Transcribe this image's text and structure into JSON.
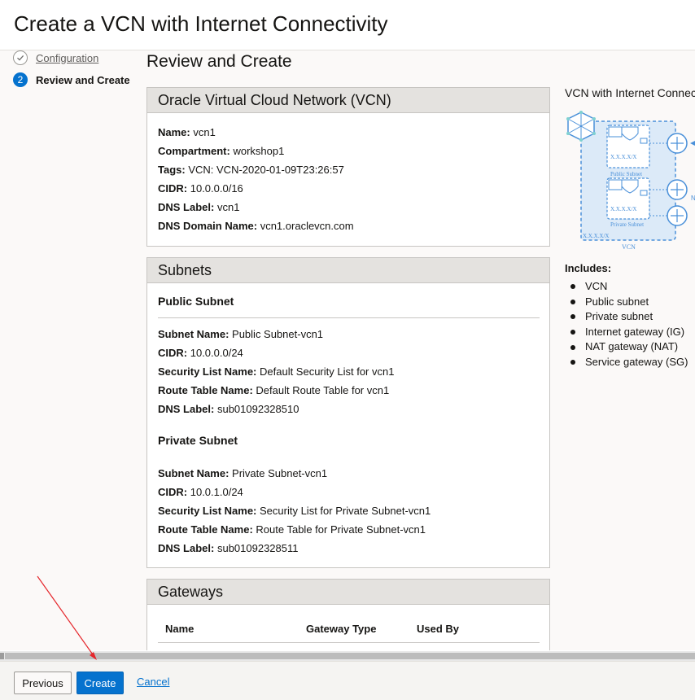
{
  "window": {
    "title": "Create a VCN with Internet Connectivity"
  },
  "steps": [
    {
      "label": "Configuration",
      "state": "complete"
    },
    {
      "number": "2",
      "label": "Review and Create",
      "state": "active"
    }
  ],
  "page_heading": "Review and Create",
  "vcn_panel": {
    "title": "Oracle Virtual Cloud Network (VCN)",
    "fields": [
      {
        "label": "Name:",
        "value": "vcn1"
      },
      {
        "label": "Compartment:",
        "value": "workshop1"
      },
      {
        "label": "Tags:",
        "value": "VCN: VCN-2020-01-09T23:26:57"
      },
      {
        "label": "CIDR:",
        "value": "10.0.0.0/16"
      },
      {
        "label": "DNS Label:",
        "value": "vcn1"
      },
      {
        "label": "DNS Domain Name:",
        "value": "vcn1.oraclevcn.com"
      }
    ]
  },
  "subnets_panel": {
    "title": "Subnets",
    "public": {
      "title": "Public Subnet",
      "fields": [
        {
          "label": "Subnet Name:",
          "value": "Public Subnet-vcn1"
        },
        {
          "label": "CIDR:",
          "value": "10.0.0.0/24"
        },
        {
          "label": "Security List Name:",
          "value": "Default Security List for vcn1"
        },
        {
          "label": "Route Table Name:",
          "value": "Default Route Table for vcn1"
        },
        {
          "label": "DNS Label:",
          "value": "sub01092328510"
        }
      ]
    },
    "private": {
      "title": "Private Subnet",
      "fields": [
        {
          "label": "Subnet Name:",
          "value": "Private Subnet-vcn1"
        },
        {
          "label": "CIDR:",
          "value": "10.0.1.0/24"
        },
        {
          "label": "Security List Name:",
          "value": "Security List for Private Subnet-vcn1"
        },
        {
          "label": "Route Table Name:",
          "value": "Route Table for Private Subnet-vcn1"
        },
        {
          "label": "DNS Label:",
          "value": "sub01092328511"
        }
      ]
    }
  },
  "gateways_panel": {
    "title": "Gateways",
    "columns": [
      "Name",
      "Gateway Type",
      "Used By"
    ]
  },
  "diagram": {
    "title": "VCN with Internet Connectivity",
    "vcn_label": "VCN",
    "vcn_cidr": "X.X.X.X/X",
    "public_cidr": "X.X.X.X/X",
    "public_label": "Public Subnet",
    "private_cidr": "X.X.X.X/X",
    "private_label": "Private Subnet",
    "nat_initial": "N"
  },
  "includes": {
    "title": "Includes:",
    "items": [
      "VCN",
      "Public subnet",
      "Private subnet",
      "Internet gateway (IG)",
      "NAT gateway (NAT)",
      "Service gateway (SG)"
    ]
  },
  "footer": {
    "previous_label": "Previous",
    "create_label": "Create",
    "cancel_label": "Cancel"
  },
  "colors": {
    "primary": "#0572ce",
    "annotation_arrow": "#e5262b",
    "diagram_blue": "#4a90d9"
  }
}
